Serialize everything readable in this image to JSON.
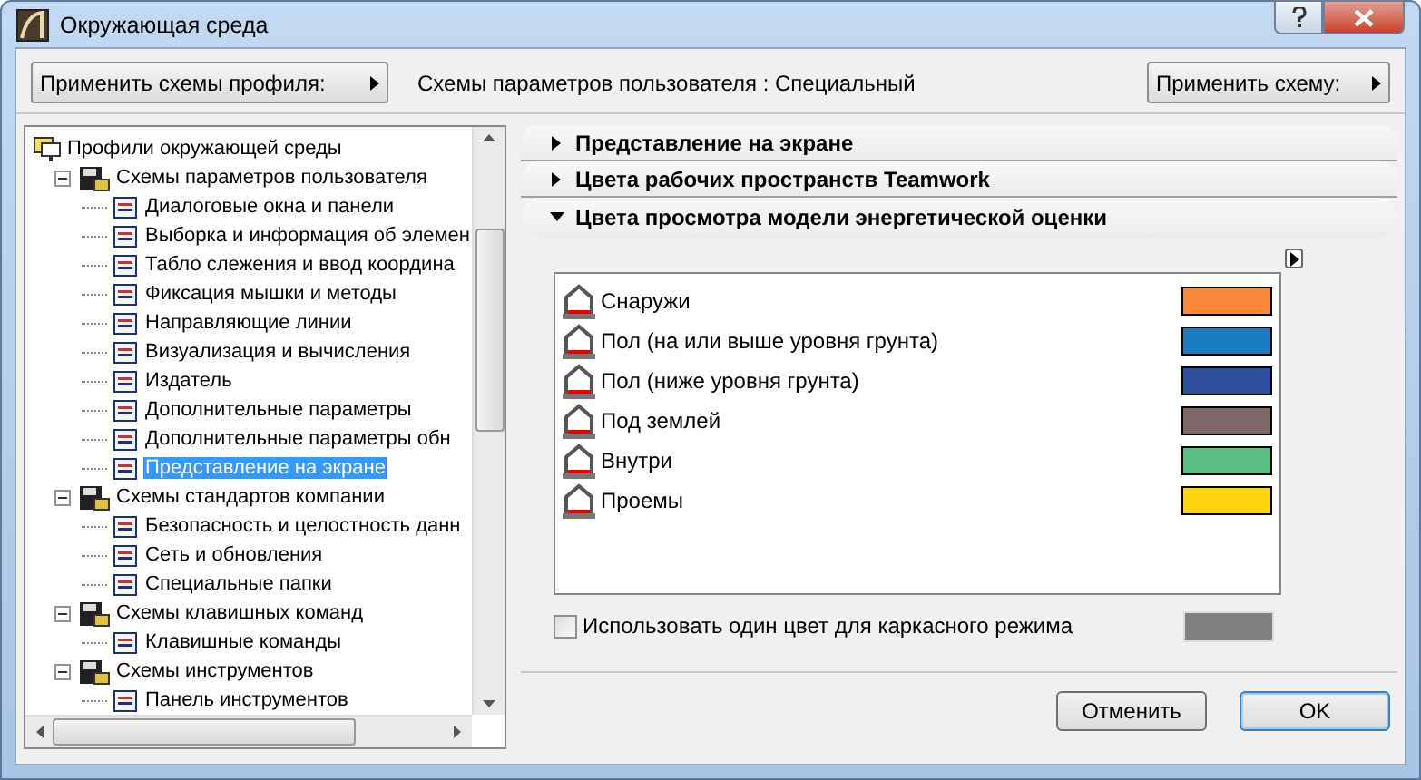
{
  "window": {
    "title": "Окружающая среда"
  },
  "toolbar": {
    "profile_button": "Применить схемы профиля:",
    "scheme_label": "Схемы параметров пользователя : Специальный",
    "apply_button": "Применить схему:"
  },
  "tree": {
    "items": [
      {
        "label": "Профили окружающей среды",
        "selected": false,
        "children": [
          {
            "label": "Схемы параметров пользователя",
            "expanded": true,
            "selected": false,
            "children": [
              {
                "label": "Диалоговые окна и панели",
                "selected": false
              },
              {
                "label": "Выборка и информация об элемен",
                "selected": false
              },
              {
                "label": "Табло слежения и ввод координа",
                "selected": false
              },
              {
                "label": "Фиксация мышки и методы",
                "selected": false
              },
              {
                "label": "Направляющие линии",
                "selected": false
              },
              {
                "label": "Визуализация и вычисления",
                "selected": false
              },
              {
                "label": "Издатель",
                "selected": false
              },
              {
                "label": "Дополнительные параметры",
                "selected": false
              },
              {
                "label": "Дополнительные параметры обн",
                "selected": false
              },
              {
                "label": "Представление на экране",
                "selected": true
              }
            ]
          },
          {
            "label": "Схемы стандартов компании",
            "expanded": true,
            "selected": false,
            "children": [
              {
                "label": "Безопасность и целостность данн",
                "selected": false
              },
              {
                "label": "Сеть и обновления",
                "selected": false
              },
              {
                "label": "Специальные папки",
                "selected": false
              }
            ]
          },
          {
            "label": "Схемы клавишных команд",
            "expanded": true,
            "selected": false,
            "children": [
              {
                "label": "Клавишные команды",
                "selected": false
              }
            ]
          },
          {
            "label": "Схемы инструментов",
            "expanded": true,
            "selected": false,
            "children": [
              {
                "label": "Панель инструментов",
                "selected": false
              }
            ]
          }
        ]
      }
    ]
  },
  "sections": [
    {
      "title": "Представление на экране",
      "expanded": false
    },
    {
      "title": "Цвета рабочих пространств Teamwork",
      "expanded": false
    },
    {
      "title": "Цвета просмотра модели энергетической оценки",
      "expanded": true
    }
  ],
  "energy_colors": {
    "items": [
      {
        "label": "Снаружи",
        "color": "#f7883a"
      },
      {
        "label": "Пол (на или выше уровня грунта)",
        "color": "#1a7abf"
      },
      {
        "label": "Пол (ниже уровня грунта)",
        "color": "#2f4f9f"
      },
      {
        "label": "Под землей",
        "color": "#806868"
      },
      {
        "label": "Внутри",
        "color": "#5abd82"
      },
      {
        "label": "Проемы",
        "color": "#fdd40f"
      }
    ]
  },
  "wireframe": {
    "label": "Использовать один цвет для каркасного режима",
    "checked": false,
    "color": "#808080"
  },
  "buttons": [
    {
      "label": "Отменить",
      "default": false
    },
    {
      "label": "OK",
      "default": true
    }
  ]
}
